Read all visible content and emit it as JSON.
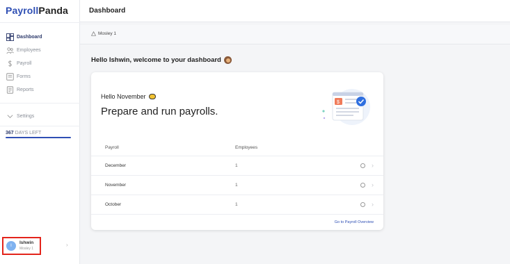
{
  "app": {
    "name_part1": "Payroll",
    "name_part2": "Panda"
  },
  "sidebar": {
    "items": [
      {
        "label": "Dashboard",
        "icon": "dashboard-icon"
      },
      {
        "label": "Employees",
        "icon": "employees-icon"
      },
      {
        "label": "Payroll",
        "icon": "dollar-icon"
      },
      {
        "label": "Forms",
        "icon": "forms-icon"
      },
      {
        "label": "Reports",
        "icon": "reports-icon"
      }
    ],
    "settings": "Settings",
    "days_left_count": "367",
    "days_left_label": " DAYS LEFT",
    "user": {
      "initial": "I",
      "name": "Ishwin",
      "org": "Mosley 1"
    }
  },
  "header": {
    "title": "Dashboard"
  },
  "breadcrumb": {
    "company": "Mosley 1"
  },
  "main": {
    "welcome": "Hello Ishwin, welcome to your dashboard",
    "card": {
      "hello_month": "Hello November",
      "headline": "Prepare and run payrolls.",
      "columns": {
        "payroll": "Payroll",
        "employees": "Employees"
      },
      "rows": [
        {
          "month": "December",
          "employees": "1"
        },
        {
          "month": "November",
          "employees": "1"
        },
        {
          "month": "October",
          "employees": "1"
        }
      ],
      "footer_link": "Go to Payroll Overview"
    }
  },
  "colors": {
    "brand": "#2f4fb4",
    "highlight": "#e3241b"
  }
}
